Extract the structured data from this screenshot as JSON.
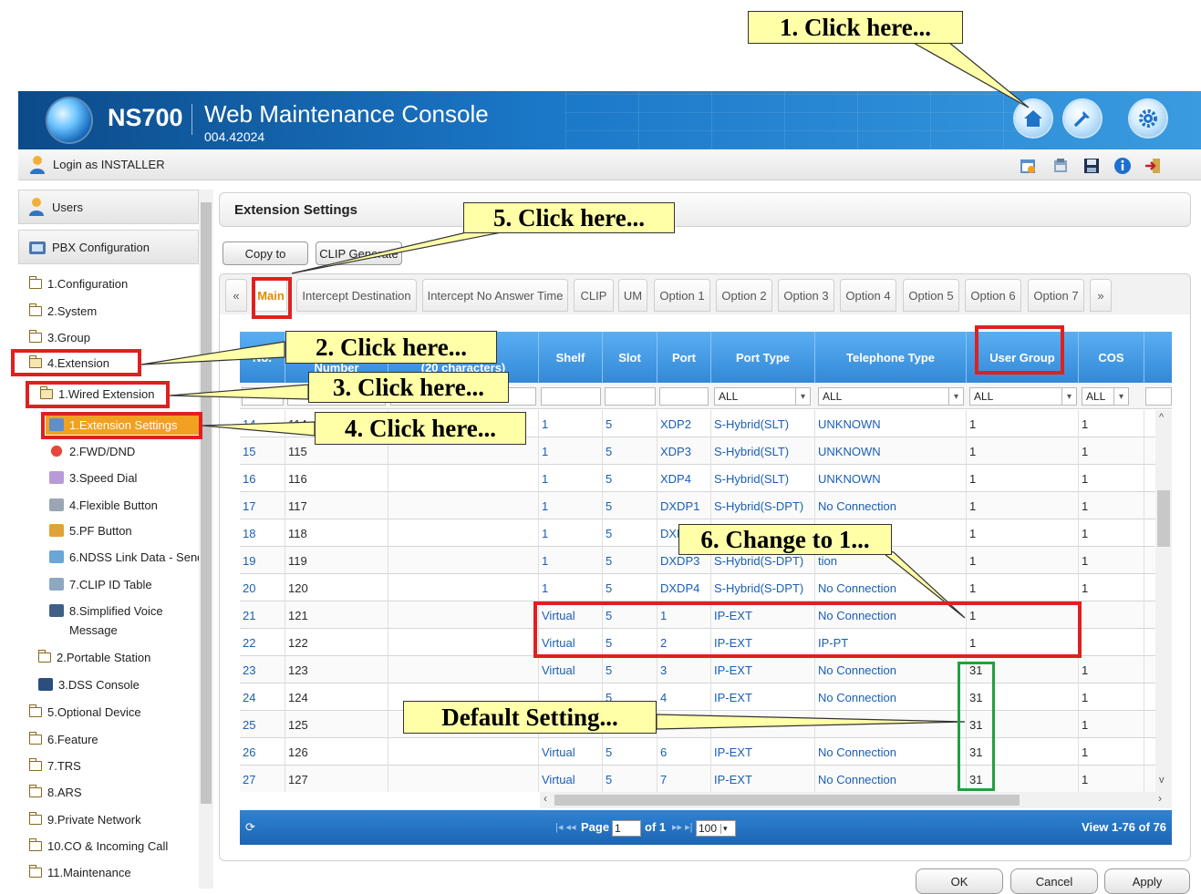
{
  "header": {
    "product": "NS700",
    "title": "Web Maintenance Console",
    "version": "004.42024"
  },
  "login": {
    "text": "Login as INSTALLER"
  },
  "sidebar": {
    "users": "Users",
    "pbx": "PBX Configuration",
    "items": {
      "configuration": "1.Configuration",
      "system": "2.System",
      "group": "3.Group",
      "extension": "4.Extension",
      "wired_extension": "1.Wired Extension",
      "extension_settings": "1.Extension Settings",
      "fwd_dnd": "2.FWD/DND",
      "speed_dial": "3.Speed Dial",
      "flexible_button": "4.Flexible Button",
      "pf_button": "5.PF Button",
      "ndss": "6.NDSS Link Data - Send",
      "clip_table": "7.CLIP ID Table",
      "svm_line1": "8.Simplified Voice",
      "svm_line2": "Message",
      "portable_station": "2.Portable Station",
      "dss_console": "3.DSS Console",
      "optional_device": "5.Optional Device",
      "feature": "6.Feature",
      "trs": "7.TRS",
      "ars": "8.ARS",
      "private_network": "9.Private Network",
      "co_incoming": "10.CO & Incoming Call",
      "maintenance": "11.Maintenance"
    }
  },
  "main": {
    "title": "Extension Settings",
    "copy_to": "Copy to",
    "clip_generate": "CLIP Generate",
    "tabs": {
      "prev": "«",
      "main": "Main",
      "intercept": "Intercept Destination",
      "intercept_no_answer": "Intercept No Answer Time",
      "clip": "CLIP",
      "um": "UM",
      "opt1": "Option 1",
      "opt2": "Option 2",
      "opt3": "Option 3",
      "opt4": "Option 4",
      "opt5": "Option 5",
      "opt6": "Option 6",
      "opt7": "Option 7",
      "next": "»"
    }
  },
  "grid": {
    "headers": {
      "no": "No.",
      "ext_number": "Number",
      "name_line": "(20 characters)",
      "shelf": "Shelf",
      "slot": "Slot",
      "port": "Port",
      "port_type": "Port Type",
      "tel_type": "Telephone Type",
      "user_group": "User Group",
      "cos": "COS"
    },
    "filters": {
      "port_type": "ALL",
      "tel_type": "ALL",
      "user_group": "ALL",
      "cos": "ALL"
    },
    "rows": [
      {
        "no": "14",
        "ext": "114",
        "shelf": "1",
        "slot": "5",
        "port": "XDP2",
        "ptype": "S-Hybrid(SLT)",
        "ttype": "UNKNOWN",
        "ug": "1",
        "cos": "1"
      },
      {
        "no": "15",
        "ext": "115",
        "shelf": "1",
        "slot": "5",
        "port": "XDP3",
        "ptype": "S-Hybrid(SLT)",
        "ttype": "UNKNOWN",
        "ug": "1",
        "cos": "1"
      },
      {
        "no": "16",
        "ext": "116",
        "shelf": "1",
        "slot": "5",
        "port": "XDP4",
        "ptype": "S-Hybrid(SLT)",
        "ttype": "UNKNOWN",
        "ug": "1",
        "cos": "1"
      },
      {
        "no": "17",
        "ext": "117",
        "shelf": "1",
        "slot": "5",
        "port": "DXDP1",
        "ptype": "S-Hybrid(S-DPT)",
        "ttype": "No Connection",
        "ug": "1",
        "cos": "1"
      },
      {
        "no": "18",
        "ext": "118",
        "shelf": "1",
        "slot": "5",
        "port": "DXD",
        "ptype": "",
        "ttype": "",
        "ug": "1",
        "cos": "1"
      },
      {
        "no": "19",
        "ext": "119",
        "shelf": "1",
        "slot": "5",
        "port": "DXDP3",
        "ptype": "S-Hybrid(S-DPT)",
        "ttype": "tion",
        "ug": "1",
        "cos": "1"
      },
      {
        "no": "20",
        "ext": "120",
        "shelf": "1",
        "slot": "5",
        "port": "DXDP4",
        "ptype": "S-Hybrid(S-DPT)",
        "ttype": "No Connection",
        "ug": "1",
        "cos": "1"
      },
      {
        "no": "21",
        "ext": "121",
        "shelf": "Virtual",
        "slot": "5",
        "port": "1",
        "ptype": "IP-EXT",
        "ttype": "No Connection",
        "ug": "1",
        "cos": ""
      },
      {
        "no": "22",
        "ext": "122",
        "shelf": "Virtual",
        "slot": "5",
        "port": "2",
        "ptype": "IP-EXT",
        "ttype": "IP-PT",
        "ug": "1",
        "cos": ""
      },
      {
        "no": "23",
        "ext": "123",
        "shelf": "Virtual",
        "slot": "5",
        "port": "3",
        "ptype": "IP-EXT",
        "ttype": "No Connection",
        "ug": "31",
        "cos": "1"
      },
      {
        "no": "24",
        "ext": "124",
        "shelf": "",
        "slot": "5",
        "port": "4",
        "ptype": "IP-EXT",
        "ttype": "No Connection",
        "ug": "31",
        "cos": "1"
      },
      {
        "no": "25",
        "ext": "125",
        "shelf": "",
        "slot": "",
        "port": "",
        "ptype": "",
        "ttype": "",
        "ug": "31",
        "cos": "1"
      },
      {
        "no": "26",
        "ext": "126",
        "shelf": "Virtual",
        "slot": "5",
        "port": "6",
        "ptype": "IP-EXT",
        "ttype": "No Connection",
        "ug": "31",
        "cos": "1"
      },
      {
        "no": "27",
        "ext": "127",
        "shelf": "Virtual",
        "slot": "5",
        "port": "7",
        "ptype": "IP-EXT",
        "ttype": "No Connection",
        "ug": "31",
        "cos": "1"
      }
    ]
  },
  "pager": {
    "page_label": "Page",
    "page_value": "1",
    "of_label": "of 1",
    "page_size": "100",
    "view_info": "View 1-76 of 76"
  },
  "footer": {
    "ok": "OK",
    "cancel": "Cancel",
    "apply": "Apply"
  },
  "annotations": {
    "a1": "1. Click here...",
    "a2": "2. Click here...",
    "a3": "3. Click here...",
    "a4": "4. Click here...",
    "a5": "5. Click here...",
    "a6": "6. Change to 1...",
    "default": "Default Setting..."
  },
  "icons": [
    "globe-logo-icon",
    "home-icon",
    "tools-icon",
    "settings-gear-icon",
    "user-icon",
    "folder-icon",
    "save-icon",
    "info-icon",
    "logout-icon"
  ],
  "colors": {
    "header_blue": "#1b78c9",
    "grid_header": "#3389d6",
    "highlight_orange": "#f2a022",
    "red_box": "#e02020",
    "green_box": "#22a040",
    "callout_yellow": "#ffffa8"
  }
}
